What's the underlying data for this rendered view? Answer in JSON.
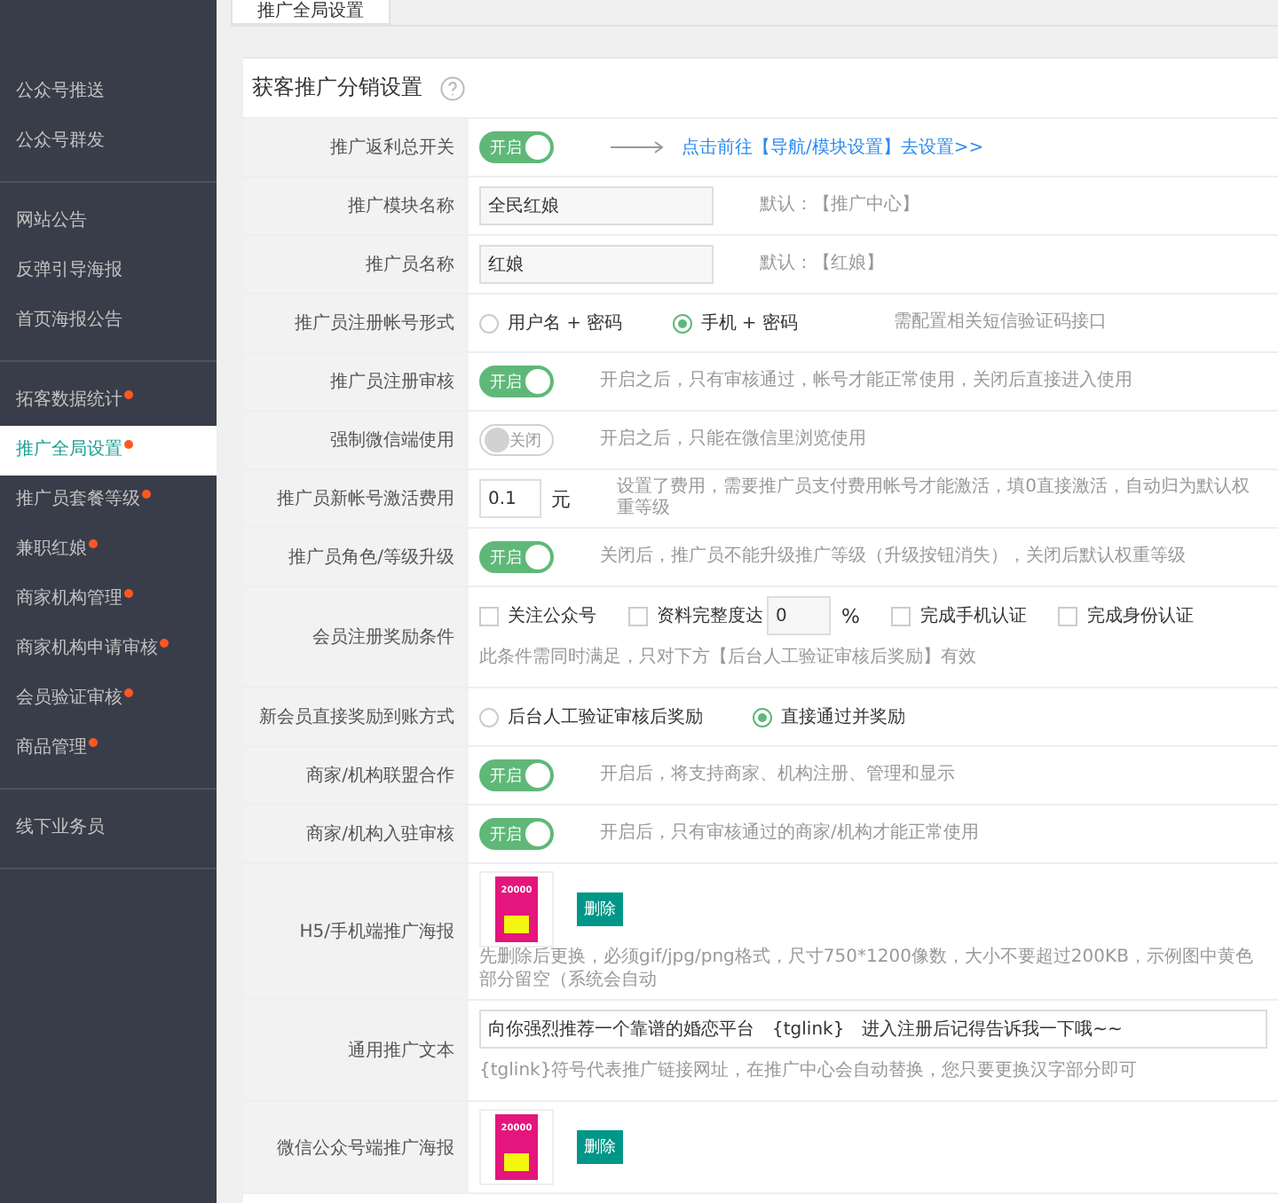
{
  "sidebar": {
    "groups": [
      [
        {
          "label": "公众号推送",
          "selected": false,
          "dot": false
        },
        {
          "label": "公众号群发",
          "selected": false,
          "dot": false
        }
      ],
      [
        {
          "label": "网站公告",
          "selected": false,
          "dot": false
        },
        {
          "label": "反弹引导海报",
          "selected": false,
          "dot": false
        },
        {
          "label": "首页海报公告",
          "selected": false,
          "dot": false
        }
      ],
      [
        {
          "label": "拓客数据统计",
          "selected": false,
          "dot": true
        },
        {
          "label": "推广全局设置",
          "selected": true,
          "dot": true
        },
        {
          "label": "推广员套餐等级",
          "selected": false,
          "dot": true
        },
        {
          "label": "兼职红娘",
          "selected": false,
          "dot": true
        },
        {
          "label": "商家机构管理",
          "selected": false,
          "dot": true
        },
        {
          "label": "商家机构申请审核",
          "selected": false,
          "dot": true
        },
        {
          "label": "会员验证审核",
          "selected": false,
          "dot": true
        },
        {
          "label": "商品管理",
          "selected": false,
          "dot": true
        }
      ],
      [
        {
          "label": "线下业务员",
          "selected": false,
          "dot": false
        }
      ]
    ]
  },
  "tabs": [
    {
      "label": "推广全局设置",
      "selected": true
    }
  ],
  "panel": {
    "title": "获客推广分销设置",
    "rows": [
      {
        "kind": "toggle",
        "label": "推广返利总开关",
        "on": true,
        "toggle_text": "开启",
        "link": "点击前往【导航/模块设置】去设置>>"
      },
      {
        "kind": "input",
        "label": "推广模块名称",
        "value": "全民红娘",
        "hint": "默认：【推广中心】"
      },
      {
        "kind": "input",
        "label": "推广员名称",
        "value": "红娘",
        "hint": "默认：【红娘】"
      },
      {
        "kind": "radio",
        "label": "推广员注册帐号形式",
        "options": [
          {
            "label": "用户名 + 密码",
            "selected": false
          },
          {
            "label": "手机 + 密码",
            "selected": true
          }
        ],
        "hint": "需配置相关短信验证码接口"
      },
      {
        "kind": "toggle",
        "label": "推广员注册审核",
        "on": true,
        "toggle_text": "开启",
        "hint": "开启之后，只有审核通过，帐号才能正常使用，关闭后直接进入使用"
      },
      {
        "kind": "toggle",
        "label": "强制微信端使用",
        "on": false,
        "toggle_text": "关闭",
        "hint": "开启之后，只能在微信里浏览使用"
      },
      {
        "kind": "fee",
        "label": "推广员新帐号激活费用",
        "value": "0.1",
        "unit": "元",
        "hint": "设置了费用，需要推广员支付费用帐号才能激活，填0直接激活，自动归为默认权重等级"
      },
      {
        "kind": "toggle",
        "label": "推广员角色/等级升级",
        "on": true,
        "toggle_text": "开启",
        "hint": "关闭后，推广员不能升级推广等级（升级按钮消失），关闭后默认权重等级"
      },
      {
        "kind": "checks",
        "label": "会员注册奖励条件",
        "options": [
          {
            "label": "关注公众号",
            "checked": false
          },
          {
            "label": "资料完整度达",
            "checked": false,
            "value": "0",
            "unit": "%"
          },
          {
            "label": "完成手机认证",
            "checked": false
          },
          {
            "label": "完成身份认证",
            "checked": false
          }
        ],
        "hint": "此条件需同时满足，只对下方【后台人工验证审核后奖励】有效"
      },
      {
        "kind": "radio",
        "label": "新会员直接奖励到账方式",
        "options": [
          {
            "label": "后台人工验证审核后奖励",
            "selected": false
          },
          {
            "label": "直接通过并奖励",
            "selected": true
          }
        ]
      },
      {
        "kind": "toggle",
        "label": "商家/机构联盟合作",
        "on": true,
        "toggle_text": "开启",
        "hint": "开启后，将支持商家、机构注册、管理和显示"
      },
      {
        "kind": "toggle",
        "label": "商家/机构入驻审核",
        "on": true,
        "toggle_text": "开启",
        "hint": "开启后，只有审核通过的商家/机构才能正常使用"
      },
      {
        "kind": "image",
        "label": "H5/手机端推广海报",
        "poster_text": "20000",
        "button": "删除",
        "hint": "先删除后更换，必须gif/jpg/png格式，尺寸750*1200像数，大小不要超过200KB，示例图中黄色部分留空（系统会自动"
      },
      {
        "kind": "text",
        "label": "通用推广文本",
        "value": "向你强烈推荐一个靠谱的婚恋平台　{tglink}　进入注册后记得告诉我一下哦~~",
        "hint": "{tglink}符号代表推广链接网址，在推广中心会自动替换，您只要更换汉字部分即可"
      },
      {
        "kind": "image",
        "label": "微信公众号端推广海报",
        "poster_text": "20000",
        "button": "删除"
      }
    ]
  }
}
